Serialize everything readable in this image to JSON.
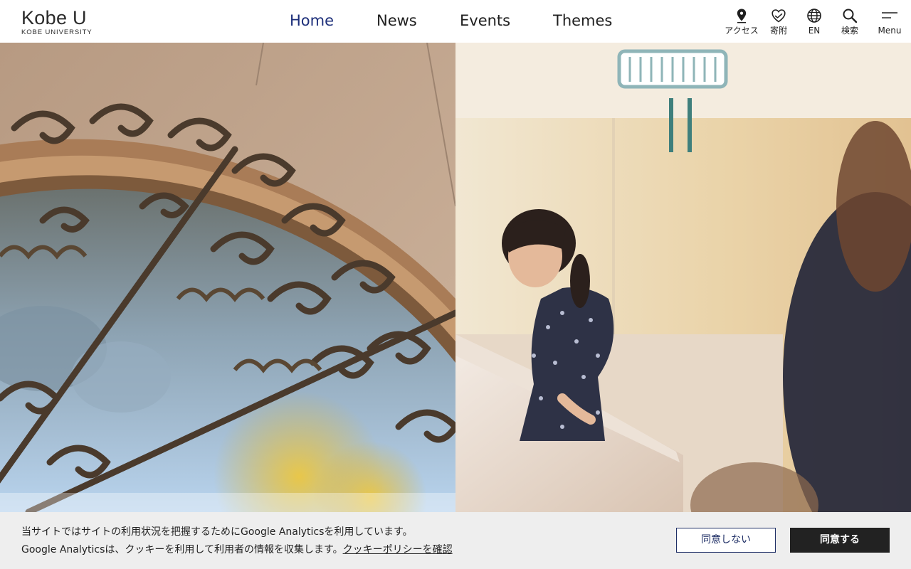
{
  "header": {
    "logo_main": "Kobe U",
    "logo_sub": "KOBE UNIVERSITY",
    "nav": [
      {
        "label": "Home",
        "active": true
      },
      {
        "label": "News",
        "active": false
      },
      {
        "label": "Events",
        "active": false
      },
      {
        "label": "Themes",
        "active": false
      }
    ],
    "tools": {
      "access": {
        "label": "アクセス",
        "icon": "map-pin-icon"
      },
      "donate": {
        "label": "寄附",
        "icon": "heart-hands-icon"
      },
      "english": {
        "label": "EN",
        "icon": "globe-icon"
      },
      "search": {
        "label": "検索",
        "icon": "search-icon"
      },
      "menu": {
        "label": "Menu",
        "icon": "menu-icon"
      }
    },
    "active_color": "#1d2f7a"
  },
  "hero": {
    "left_photo": "ornate-arched-window-photo",
    "right_photo": "student-on-stairs-photo"
  },
  "cookie_banner": {
    "line1": "当サイトではサイトの利用状況を把握するためにGoogle Analyticsを利用しています。",
    "line2_prefix": "Google Analyticsは、クッキーを利用して利用者の情報を収集します。",
    "policy_link": "クッキーポリシーを確認",
    "decline_label": "同意しない",
    "accept_label": "同意する",
    "background": "#eeeeee",
    "accept_color": "#222222",
    "decline_border": "#1f2f66"
  }
}
